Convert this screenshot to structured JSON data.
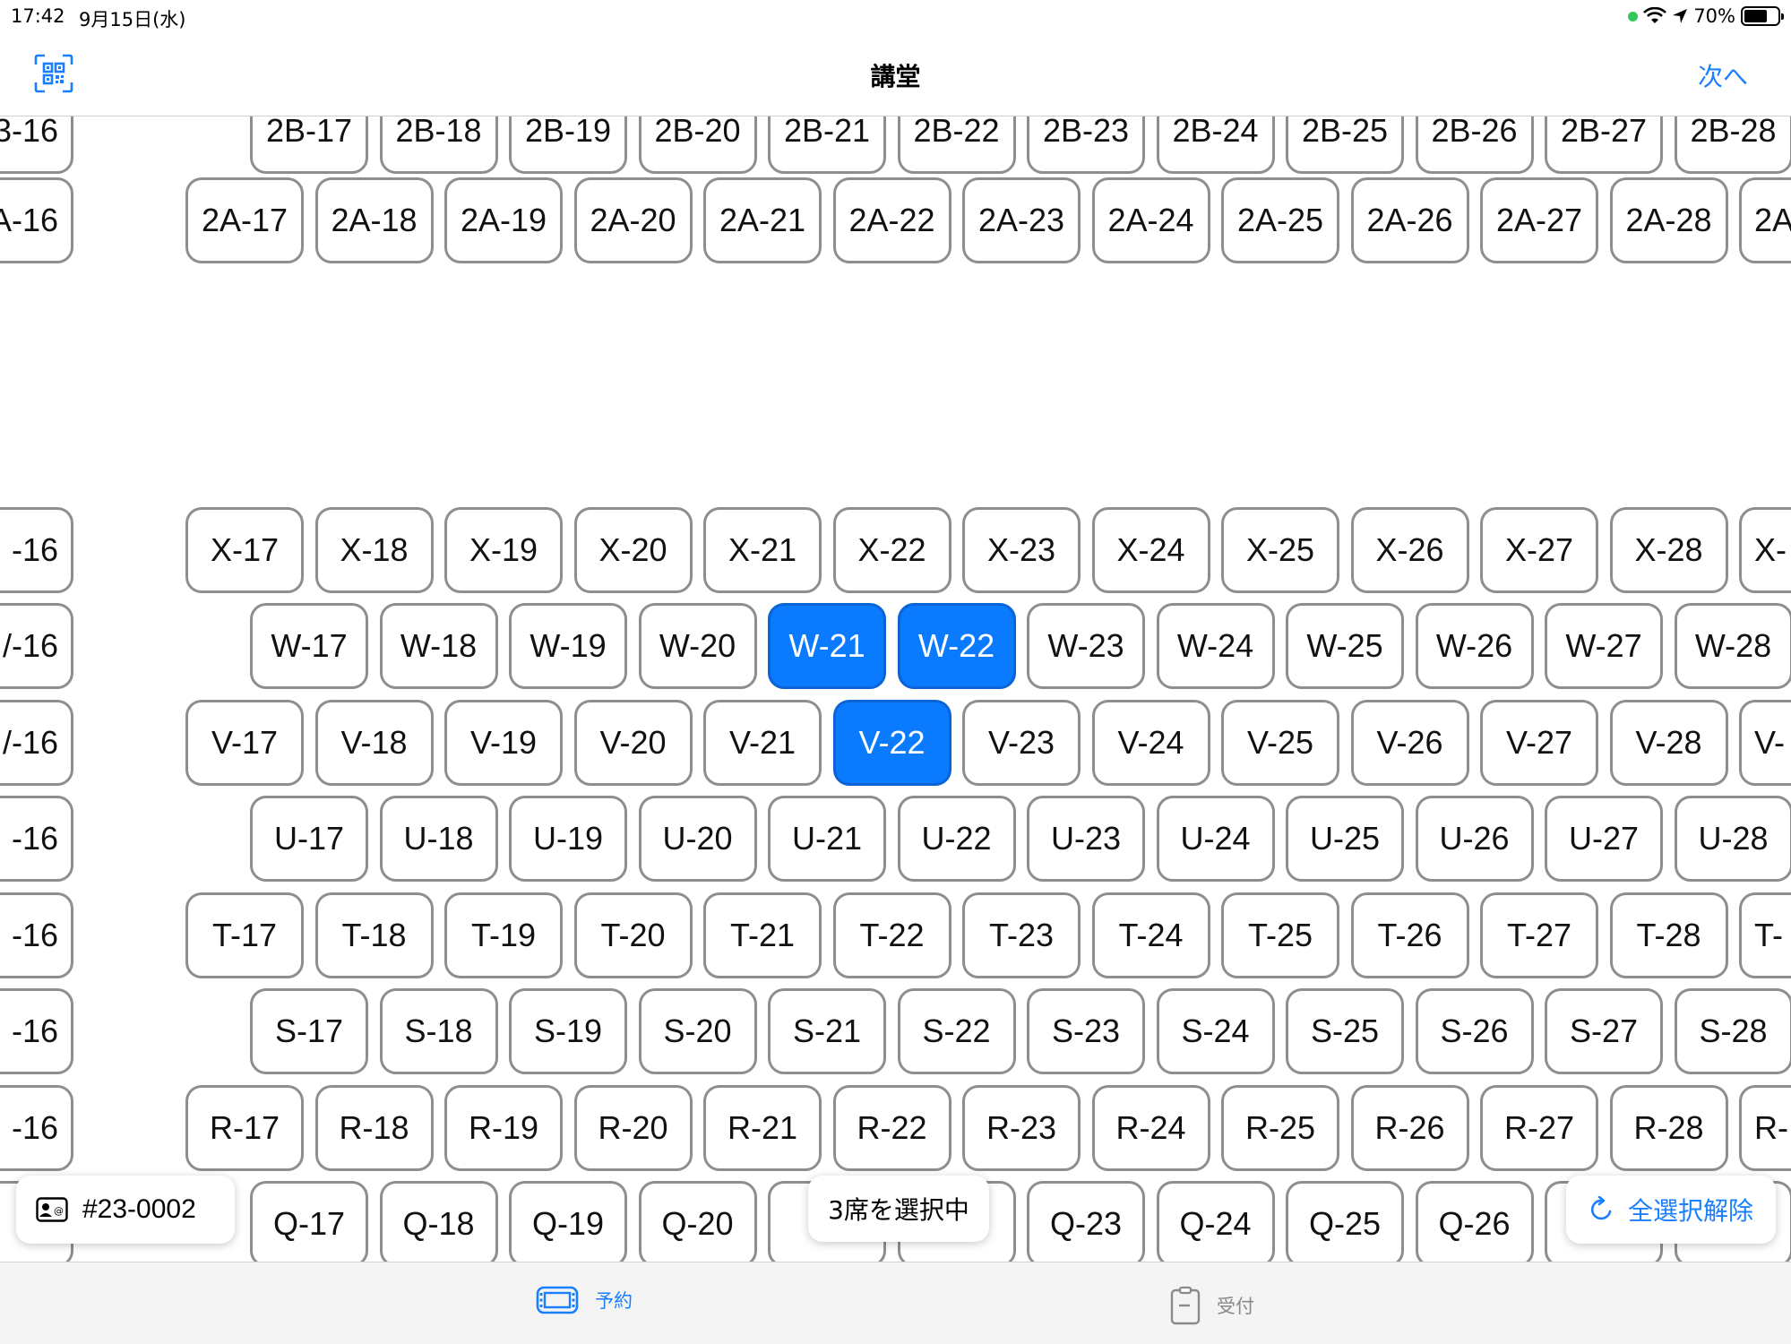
{
  "status_bar": {
    "time": "17:42",
    "date": "9月15日(水)",
    "battery": "70%",
    "battery_level": 0.7
  },
  "nav": {
    "title": "講堂",
    "next_label": "次へ",
    "qr_icon": "qr-scan-icon"
  },
  "seat_rows": [
    {
      "row": "2B",
      "edge_left": "3-16",
      "seats": [
        "2B-17",
        "2B-18",
        "2B-19",
        "2B-20",
        "2B-21",
        "2B-22",
        "2B-23",
        "2B-24",
        "2B-25",
        "2B-26",
        "2B-27",
        "2B-28"
      ],
      "edge_right": null,
      "offset": true,
      "partial_top": true
    },
    {
      "row": "2A",
      "edge_left": "A-16",
      "seats": [
        "2A-17",
        "2A-18",
        "2A-19",
        "2A-20",
        "2A-21",
        "2A-22",
        "2A-23",
        "2A-24",
        "2A-25",
        "2A-26",
        "2A-27",
        "2A-28"
      ],
      "edge_right": "2A",
      "offset": false
    },
    {
      "row": "X",
      "edge_left": "-16",
      "seats": [
        "X-17",
        "X-18",
        "X-19",
        "X-20",
        "X-21",
        "X-22",
        "X-23",
        "X-24",
        "X-25",
        "X-26",
        "X-27",
        "X-28"
      ],
      "edge_right": "X-",
      "offset": false
    },
    {
      "row": "W",
      "edge_left": "/-16",
      "seats": [
        "W-17",
        "W-18",
        "W-19",
        "W-20",
        "W-21",
        "W-22",
        "W-23",
        "W-24",
        "W-25",
        "W-26",
        "W-27",
        "W-28"
      ],
      "edge_right": null,
      "offset": true
    },
    {
      "row": "V",
      "edge_left": "/-16",
      "seats": [
        "V-17",
        "V-18",
        "V-19",
        "V-20",
        "V-21",
        "V-22",
        "V-23",
        "V-24",
        "V-25",
        "V-26",
        "V-27",
        "V-28"
      ],
      "edge_right": "V-",
      "offset": false
    },
    {
      "row": "U",
      "edge_left": "-16",
      "seats": [
        "U-17",
        "U-18",
        "U-19",
        "U-20",
        "U-21",
        "U-22",
        "U-23",
        "U-24",
        "U-25",
        "U-26",
        "U-27",
        "U-28"
      ],
      "edge_right": null,
      "offset": true
    },
    {
      "row": "T",
      "edge_left": "-16",
      "seats": [
        "T-17",
        "T-18",
        "T-19",
        "T-20",
        "T-21",
        "T-22",
        "T-23",
        "T-24",
        "T-25",
        "T-26",
        "T-27",
        "T-28"
      ],
      "edge_right": "T-",
      "offset": false
    },
    {
      "row": "S",
      "edge_left": "-16",
      "seats": [
        "S-17",
        "S-18",
        "S-19",
        "S-20",
        "S-21",
        "S-22",
        "S-23",
        "S-24",
        "S-25",
        "S-26",
        "S-27",
        "S-28"
      ],
      "edge_right": null,
      "offset": true
    },
    {
      "row": "R",
      "edge_left": "-16",
      "seats": [
        "R-17",
        "R-18",
        "R-19",
        "R-20",
        "R-21",
        "R-22",
        "R-23",
        "R-24",
        "R-25",
        "R-26",
        "R-27",
        "R-28"
      ],
      "edge_right": "R-",
      "offset": false
    },
    {
      "row": "Q",
      "edge_left": "-",
      "seats": [
        "Q-17",
        "Q-18",
        "Q-19",
        "Q-20",
        "Q",
        "",
        "Q-23",
        "Q-24",
        "Q-25",
        "Q-26",
        "",
        ""
      ],
      "edge_right": null,
      "offset": true
    }
  ],
  "selected_seats": [
    "W-21",
    "W-22",
    "V-22"
  ],
  "member": {
    "id": "#23-0002",
    "icon": "member-card-icon"
  },
  "selection_count": "3席を選択中",
  "clear_all": {
    "label": "全選択解除",
    "icon": "reload-icon"
  },
  "tabs": [
    {
      "label": "予約",
      "icon": "ticket-icon",
      "active": true
    },
    {
      "label": "受付",
      "icon": "clipboard-icon",
      "active": false
    }
  ],
  "colors": {
    "accent": "#1a7fff",
    "selected_seat": "#0a7aff",
    "seat_border": "#8e8e8e",
    "wifi_dot": "#34c759"
  }
}
